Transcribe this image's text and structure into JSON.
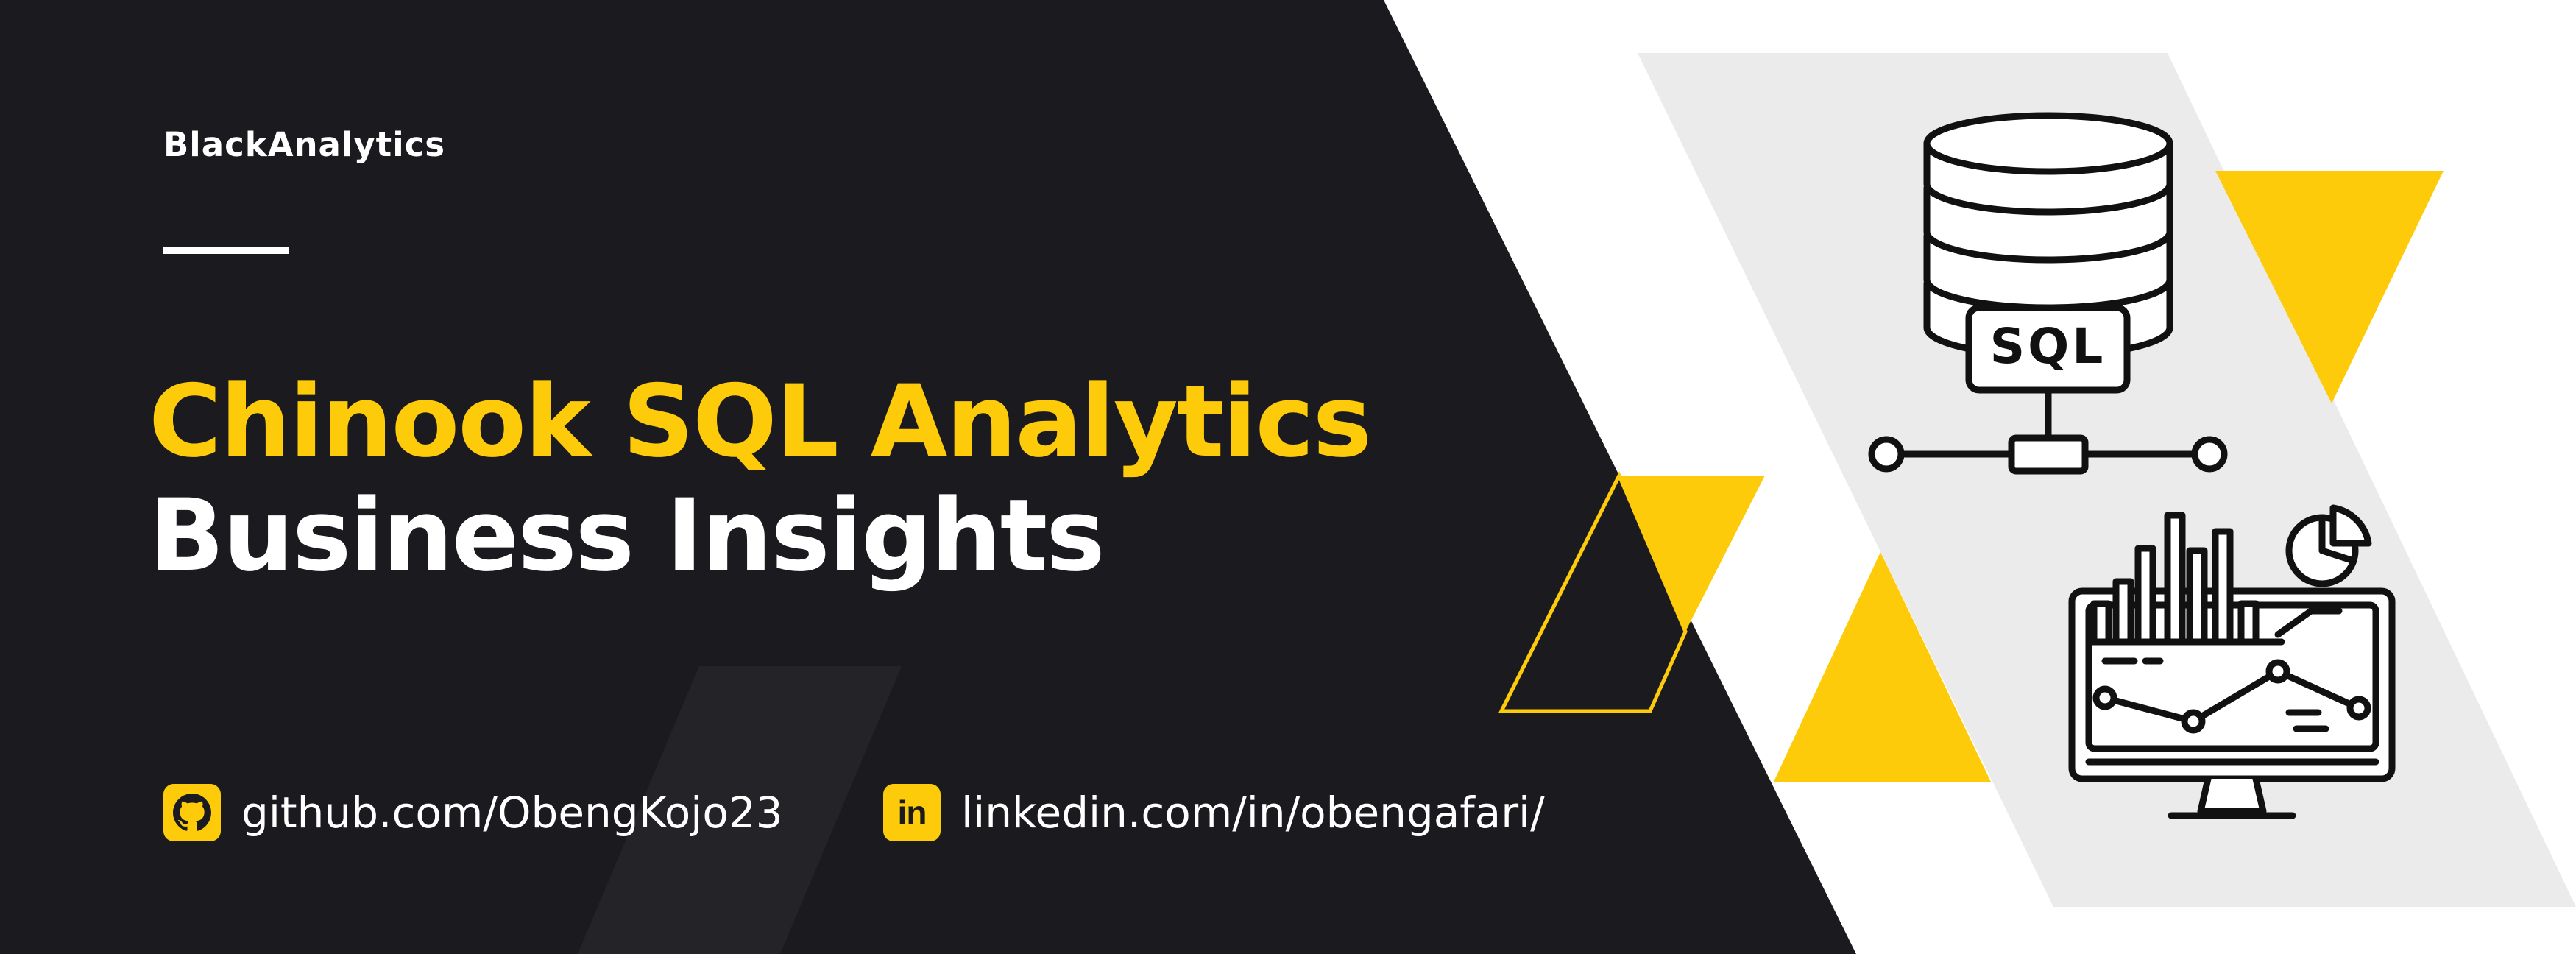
{
  "brand": {
    "name": "BlackAnalytics"
  },
  "title": {
    "line1": "Chinook SQL Analytics",
    "line2": "Business Insights"
  },
  "links": {
    "github": {
      "text": "github.com/ObengKojo23",
      "icon": "github-icon"
    },
    "linkedin": {
      "text": "linkedin.com/in/obengafari/",
      "icon": "linkedin-icon",
      "icon_text": "in"
    }
  },
  "illustration": {
    "badge_text": "SQL",
    "icons": [
      "database-icon",
      "network-icon",
      "dashboard-monitor-icon",
      "pie-chart-icon",
      "bar-chart-icon",
      "line-chart-icon"
    ]
  },
  "colors": {
    "background_dark": "#1b1b1f",
    "accent_yellow": "#fdcb0a",
    "panel_gray": "#ebebeb",
    "white": "#ffffff",
    "outline": "#111111"
  }
}
